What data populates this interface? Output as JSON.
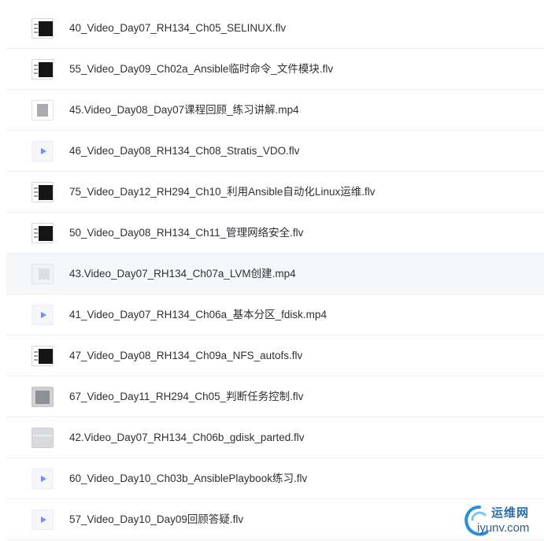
{
  "file_list": {
    "rows": [
      {
        "name": "40_Video_Day07_RH134_Ch05_SELINUX.flv",
        "thumb": "terminal"
      },
      {
        "name": "55_Video_Day09_Ch02a_Ansible临时命令_文件模块.flv",
        "thumb": "terminal"
      },
      {
        "name": "45.Video_Day08_Day07课程回顾_练习讲解.mp4",
        "thumb": "doc"
      },
      {
        "name": "46_Video_Day08_RH134_Ch08_Stratis_VDO.flv",
        "thumb": "video"
      },
      {
        "name": "75_Video_Day12_RH294_Ch10_利用Ansible自动化Linux运维.flv",
        "thumb": "terminal"
      },
      {
        "name": "50_Video_Day08_RH134_Ch11_管理网络安全.flv",
        "thumb": "terminal"
      },
      {
        "name": "43.Video_Day07_RH134_Ch07a_LVM创建.mp4",
        "thumb": "light"
      },
      {
        "name": "41_Video_Day07_RH134_Ch06a_基本分区_fdisk.mp4",
        "thumb": "video"
      },
      {
        "name": "47_Video_Day08_RH134_Ch09a_NFS_autofs.flv",
        "thumb": "terminal"
      },
      {
        "name": "67_Video_Day11_RH294_Ch05_判断任务控制.flv",
        "thumb": "docgray"
      },
      {
        "name": "42.Video_Day07_RH134_Ch06b_gdisk_parted.flv",
        "thumb": "wide"
      },
      {
        "name": "60_Video_Day10_Ch03b_AnsiblePlaybook练习.flv",
        "thumb": "video"
      },
      {
        "name": "57_Video_Day10_Day09回顾答疑.flv",
        "thumb": "video"
      }
    ],
    "hovered_row_index": 6
  },
  "watermark": {
    "cn_text": "运维网",
    "en_text": "iyunv.com"
  },
  "colors": {
    "play_accent": "#6f8ff2",
    "divider": "#eef0f4",
    "hover_bg": "#f6f7f9"
  }
}
